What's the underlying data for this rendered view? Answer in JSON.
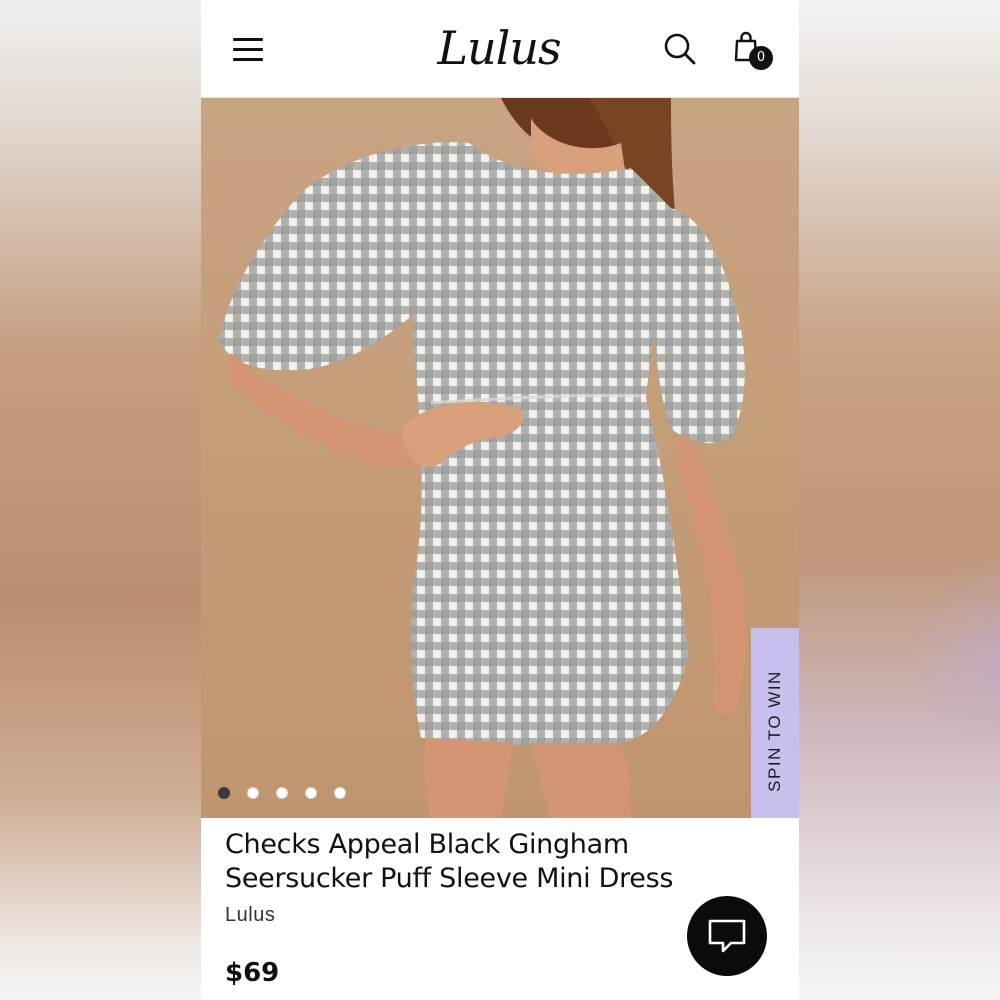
{
  "header": {
    "menu_icon": "hamburger-menu-icon",
    "logo_text": "Lulus",
    "search_icon": "search-icon",
    "cart_icon": "shopping-bag-icon",
    "cart_count": "0"
  },
  "gallery": {
    "total_images": 5,
    "active_index": 0,
    "image_subject": "model wearing gingham puff sleeve mini dress"
  },
  "promo": {
    "spin_label": "SPIN TO WIN",
    "color": "#c8bfee"
  },
  "product": {
    "title": "Checks Appeal Black Gingham Seersucker Puff Sleeve Mini Dress",
    "brand": "Lulus",
    "price": "$69"
  },
  "chat": {
    "icon": "chat-bubble-icon"
  },
  "colors": {
    "hero_background": "#c39c78",
    "text": "#111111",
    "chat_button": "#0b0b0b"
  }
}
